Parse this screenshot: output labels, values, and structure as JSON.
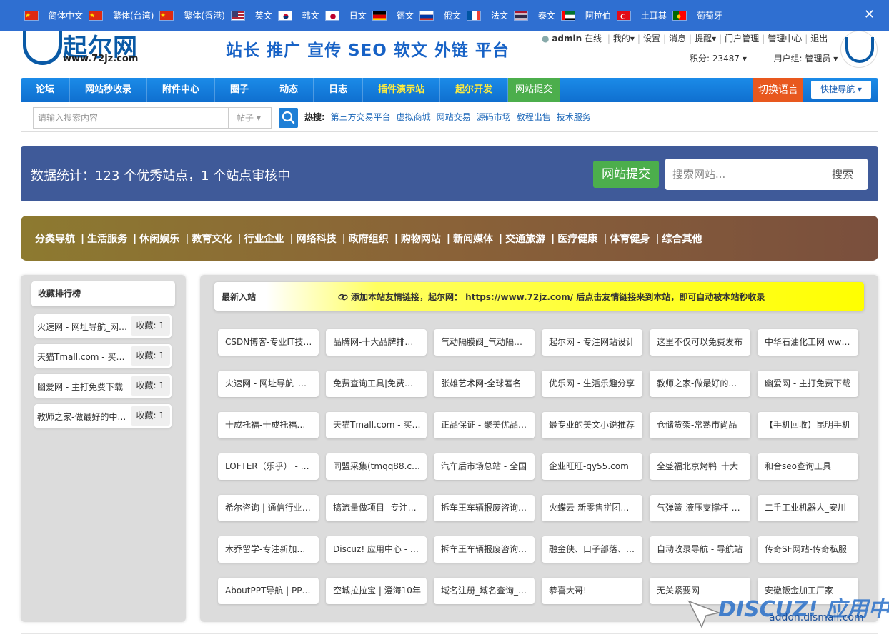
{
  "language_bar": {
    "languages": [
      {
        "label": "简体中文",
        "flag": "cn"
      },
      {
        "label": "繁体(台湾)",
        "flag": "cn"
      },
      {
        "label": "繁体(香港)",
        "flag": "cn"
      },
      {
        "label": "英文",
        "flag": "us"
      },
      {
        "label": "韩文",
        "flag": "kr"
      },
      {
        "label": "日文",
        "flag": "jp"
      },
      {
        "label": "德文",
        "flag": "de"
      },
      {
        "label": "俄文",
        "flag": "ru"
      },
      {
        "label": "法文",
        "flag": "fr"
      },
      {
        "label": "泰文",
        "flag": "th"
      },
      {
        "label": "阿拉伯",
        "flag": "ae"
      },
      {
        "label": "土耳其",
        "flag": "tr"
      },
      {
        "label": "葡萄牙",
        "flag": "pt"
      }
    ],
    "close_label": "✕"
  },
  "header": {
    "logo_text": "起尔网",
    "logo_url": "www.72jz.com",
    "slogan": "站长 推广 宣传 SEO 软文 外链 平台",
    "user_name": "admin",
    "user_status": "在线",
    "user_links": [
      "我的▾",
      "设置",
      "消息",
      "提醒▾",
      "门户管理",
      "管理中心",
      "退出"
    ],
    "points": "积分: 23487 ▾",
    "usergroup": "用户组: 管理员 ▾"
  },
  "nav": {
    "items": [
      {
        "label": "论坛",
        "style": ""
      },
      {
        "label": "网站秒收录",
        "style": ""
      },
      {
        "label": "附件中心",
        "style": ""
      },
      {
        "label": "圈子",
        "style": ""
      },
      {
        "label": "动态",
        "style": ""
      },
      {
        "label": "日志",
        "style": ""
      },
      {
        "label": "插件演示站",
        "style": "hl"
      },
      {
        "label": "起尔开发",
        "style": "hl"
      },
      {
        "label": "网站提交",
        "style": "act"
      }
    ],
    "switch_lang": "切换语言",
    "quick_nav": "快捷导航 ▾"
  },
  "search": {
    "placeholder": "请输入搜索内容",
    "type": "帖子 ▾",
    "hot_label": "热搜:",
    "hot_links": [
      "第三方交易平台",
      "虚拟商城",
      "网站交易",
      "源码市场",
      "教程出售",
      "技术服务"
    ]
  },
  "stats": {
    "text": "数据统计：123 个优秀站点，1 个站点审核中",
    "submit": "网站提交",
    "search_placeholder": "搜索网站...",
    "search_button": "搜索"
  },
  "categories": [
    "分类导航",
    "生活服务",
    "休闲娱乐",
    "教育文化",
    "行业企业",
    "网络科技",
    "政府组织",
    "购物网站",
    "新闻媒体",
    "交通旅游",
    "医疗健康",
    "体育健身",
    "综合其他"
  ],
  "sidebar": {
    "title": "收藏排行榜",
    "items": [
      {
        "name": "火速网 - 网址导航_网址大全",
        "count": "收藏: 1"
      },
      {
        "name": "天猫Tmall.com - 买正品",
        "count": "收藏: 1"
      },
      {
        "name": "幽爱网 - 主打免费下载",
        "count": "收藏: 1"
      },
      {
        "name": "教师之家-做最好的中小学",
        "count": "收藏: 1"
      }
    ]
  },
  "main": {
    "title": "最新入站",
    "notice_icon": "link-icon",
    "notice": "添加本站友情链接，起尔网： https://www.72jz.com/ 后点击友情链接来到本站，即可自动被本站秒收录",
    "tiles": [
      [
        "CSDN博客-专业IT技术社区",
        "品牌网-十大品牌排行榜",
        "气动隔膜阀_气动隔膜泵",
        "起尔网 - 专注网站设计",
        "这里不仅可以免费发布",
        "中华石油化工网 www.com"
      ],
      [
        "火速网 - 网址导航_网址",
        "免费查询工具|免费查询",
        "张雄艺术网-全球著名",
        "优乐网 - 生活乐趣分享",
        "教师之家-做最好的中小",
        "幽爱网 - 主打免费下载"
      ],
      [
        "十成托福-十成托福官网",
        "天猫Tmall.com - 买正品",
        "正品保证 - 聚美优品官网",
        "最专业的美文小说推荐",
        "仓储货架-常熟市尚品",
        "【手机回收】昆明手机"
      ],
      [
        "LOFTER（乐乎） - 让兴趣",
        "同盟采集(tmqq88.com)",
        "汽车后市场总站 - 全国",
        "企业旺旺-qy55.com",
        "全盛福北京烤鸭_十大",
        "和合seo查询工具"
      ],
      [
        "希尔咨询 | 通信行业咨询",
        "搞流量做项目--专注网赚",
        "拆车王车辆报废咨询中心",
        "火蝶云-新零售拼团系统",
        "气弹簧-液压支撑杆-厂家",
        "二手工业机器人_安川"
      ],
      [
        "木乔留学-专注新加坡留学",
        "Discuz! 应用中心 - 插件",
        "拆车王车辆报废咨询中心",
        "融金侠、口子部落、门户",
        "自动收录导航 - 导航站",
        "传奇SF网站-传奇私服"
      ],
      [
        "AboutPPT导航 | PPT资源",
        "空城拉拉宝 | 澄海10年",
        "域名注册_域名查询_主机",
        "恭喜大哥!",
        "无关紧要网",
        "安徽钣金加工厂家"
      ]
    ]
  },
  "watermark": {
    "brand": "DISCUZ! 应用中心",
    "url": "addon.dismall.com"
  }
}
